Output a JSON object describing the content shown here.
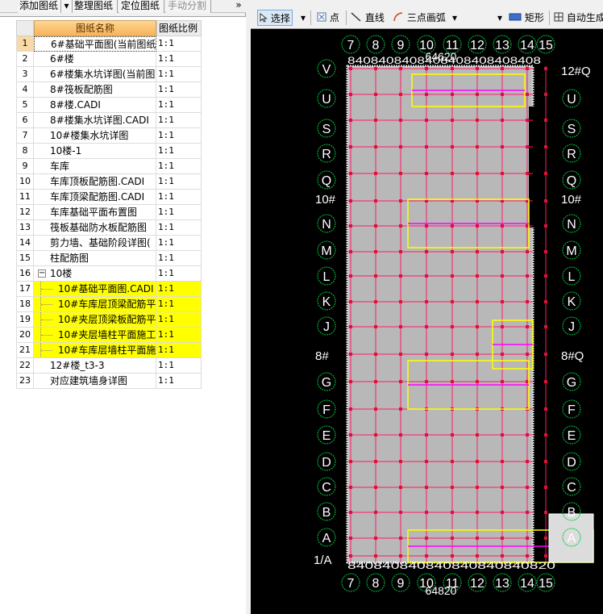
{
  "left_toolbar": {
    "add_drawing": "添加图纸",
    "organize": "整理图纸",
    "locate": "定位图纸",
    "manual_split": "手动分割",
    "overflow": "»"
  },
  "grid": {
    "col_name": "图纸名称",
    "col_scale": "图纸比例",
    "rows": [
      {
        "num": "1",
        "name": "6#基础平面图(当前图纸",
        "scale": "1:1"
      },
      {
        "num": "2",
        "name": "6#楼",
        "scale": "1:1"
      },
      {
        "num": "3",
        "name": "6#楼集水坑详图(当前图",
        "scale": "1:1"
      },
      {
        "num": "4",
        "name": "8#筏板配筋图",
        "scale": "1:1"
      },
      {
        "num": "5",
        "name": "8#楼.CADI",
        "scale": "1:1"
      },
      {
        "num": "6",
        "name": "8#楼集水坑详图.CADI",
        "scale": "1:1"
      },
      {
        "num": "7",
        "name": "10#楼集水坑详图",
        "scale": "1:1"
      },
      {
        "num": "8",
        "name": "10楼-1",
        "scale": "1:1"
      },
      {
        "num": "9",
        "name": "车库",
        "scale": "1:1"
      },
      {
        "num": "10",
        "name": "车库顶板配筋图.CADI",
        "scale": "1:1"
      },
      {
        "num": "11",
        "name": "车库顶梁配筋图.CADI",
        "scale": "1:1"
      },
      {
        "num": "12",
        "name": "车库基础平面布置图",
        "scale": "1:1"
      },
      {
        "num": "13",
        "name": "筏板基础防水板配筋图",
        "scale": "1:1"
      },
      {
        "num": "14",
        "name": "剪力墙、基础阶段详图(",
        "scale": "1:1"
      },
      {
        "num": "15",
        "name": "柱配筋图",
        "scale": "1:1"
      },
      {
        "num": "16",
        "name": "10楼",
        "scale": "1:1",
        "expander": "−"
      },
      {
        "num": "17",
        "name": "10#基础平面图.CADI",
        "scale": "1:1"
      },
      {
        "num": "18",
        "name": "10#车库层顶梁配筋平",
        "scale": "1:1"
      },
      {
        "num": "19",
        "name": "10#夹层顶梁板配筋平",
        "scale": "1:1"
      },
      {
        "num": "20",
        "name": "10#夹层墙柱平面施工",
        "scale": "1:1"
      },
      {
        "num": "21",
        "name": "10#车库层墙柱平面施",
        "scale": "1:1"
      },
      {
        "num": "22",
        "name": "12#楼_t3-3",
        "scale": "1:1"
      },
      {
        "num": "23",
        "name": "对应建筑墙身详图",
        "scale": "1:1"
      }
    ]
  },
  "right_toolbar": {
    "select": "选择",
    "point": "点",
    "line": "直线",
    "arc": "三点画弧",
    "rect": "矩形",
    "auto": "自动生成"
  },
  "cad": {
    "top_axes": [
      "7",
      "8",
      "9",
      "10",
      "11",
      "12",
      "13",
      "14",
      "15"
    ],
    "bottom_axes": [
      "7",
      "8",
      "9",
      "10",
      "11",
      "12",
      "13",
      "14",
      "15"
    ],
    "left_axes": [
      "V",
      "U",
      "S",
      "R",
      "Q",
      "N",
      "M",
      "L",
      "K",
      "J",
      "G",
      "F",
      "E",
      "D",
      "C",
      "B",
      "A"
    ],
    "right_axes": [
      "U",
      "S",
      "R",
      "Q",
      "N",
      "M",
      "L",
      "K",
      "J",
      "G",
      "F",
      "E",
      "D",
      "C",
      "B",
      "A"
    ],
    "top_dim": "64620",
    "bottom_dim": "64820",
    "top_dim_row": "8408408408408408408408408",
    "bottom_dim_row": "840840840840840840840820",
    "left_labels": [
      "10#",
      "8#",
      "1/A"
    ],
    "right_labels": [
      "12#Q",
      "10#",
      "8#Q"
    ],
    "colors": {
      "background": "#000000",
      "slab": "#b8b8b8",
      "grid_line": "#ff1a66",
      "magenta": "#ff00ff",
      "yellow": "#ffff00",
      "axis_circle": "#00cc44",
      "text": "#ffffff"
    }
  }
}
